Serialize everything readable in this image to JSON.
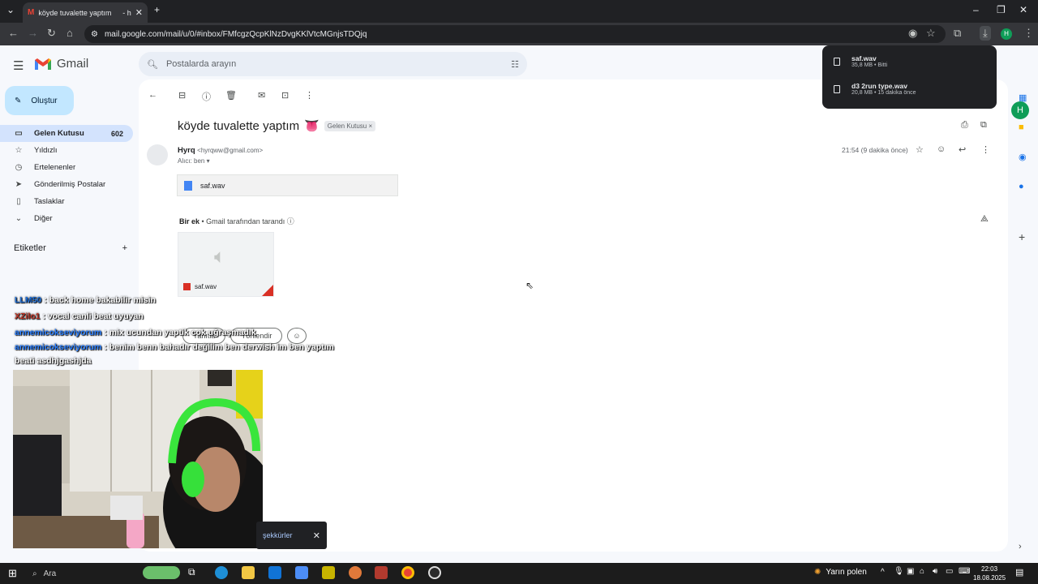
{
  "browser": {
    "tab_title": "köyde tuvalette yaptım",
    "tab_suffix": "- h",
    "url": "mail.google.com/mail/u/0/#inbox/FMfcgzQcpKlNzDvgKKlVtcMGnjsTDQjq",
    "profile_initial": "H"
  },
  "downloads": [
    {
      "name": "saf.wav",
      "status": "35,8 MB • Bitti"
    },
    {
      "name": "d3 2run type.wav",
      "status": "20,8 MB • 15 dakika önce"
    }
  ],
  "gmail": {
    "brand": "Gmail",
    "search_placeholder": "Postalarda arayın",
    "compose_label": "Oluştur",
    "nav": [
      {
        "label": "Gelen Kutusu",
        "count": "602",
        "icon": "inbox-icon"
      },
      {
        "label": "Yıldızlı",
        "icon": "star-icon"
      },
      {
        "label": "Ertelenenler",
        "icon": "clock-icon"
      },
      {
        "label": "Gönderilmiş Postalar",
        "icon": "send-icon"
      },
      {
        "label": "Taslaklar",
        "icon": "draft-icon"
      },
      {
        "label": "Diğer",
        "icon": "chevron-down-icon"
      }
    ],
    "labels_header": "Etiketler",
    "account_initial": "H"
  },
  "email": {
    "subject": "köyde tuvalette yaptım",
    "subject_emoji": "👅",
    "label_chip": "Gelen Kutusu",
    "sender_name": "Hyrq",
    "sender_email": "<hyrqww@gmail.com>",
    "to_line": "Alıcı: ben",
    "time": "21:54 (9 dakika önce)",
    "attachment_chip": "saf.wav",
    "attachments_header": "Bir ek",
    "scan_note": "• Gmail tarafından tarandı",
    "thumb_filename": "saf.wav",
    "reply_label": "Yanıtla",
    "forward_label": "Yönlendir"
  },
  "chat": [
    {
      "user": "LLM50",
      "msg": ": back home bakabilir misin",
      "color": "#1e6fd9"
    },
    {
      "user": "XZilo1",
      "msg": ": vocal canli beat uyuyan",
      "color": "#c0392b"
    },
    {
      "user": "annemicokseviyorum",
      "msg": ": mix ucundan yaptik cok uğraşmadık",
      "color": "#2a7fff"
    },
    {
      "user": "annemicokseviyorum",
      "msg": ": benim benn bahadır değilim ben derwish im ben yaptım beati asdhjgashjda",
      "color": "#2a7fff"
    }
  ],
  "toast": {
    "text": "şekkürler"
  },
  "taskbar": {
    "search_label": "Ara",
    "weather": "Yarın polen",
    "time": "22:03",
    "date": "18.08.2025"
  }
}
